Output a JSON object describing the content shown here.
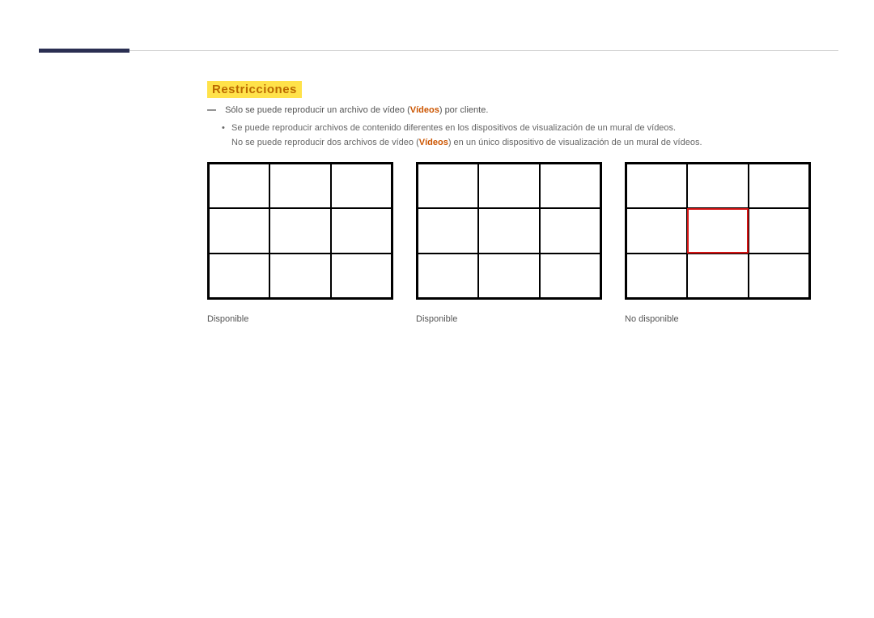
{
  "heading": "Restricciones",
  "note": {
    "marker": "―",
    "prefix": "Sólo se puede reproducir un archivo de vídeo (",
    "keyword": "Vídeos",
    "suffix": ") por cliente."
  },
  "bullet1": "Se puede reproducir archivos de contenido diferentes en los dispositivos de visualización de un mural de vídeos.",
  "bullet2": {
    "prefix": "No se puede reproducir dos archivos de vídeo (",
    "keyword": "Vídeos",
    "suffix": ") en un único dispositivo de visualización de un mural de vídeos."
  },
  "captions": {
    "grid1": "Disponible",
    "grid2": "Disponible",
    "grid3": "No disponible"
  }
}
